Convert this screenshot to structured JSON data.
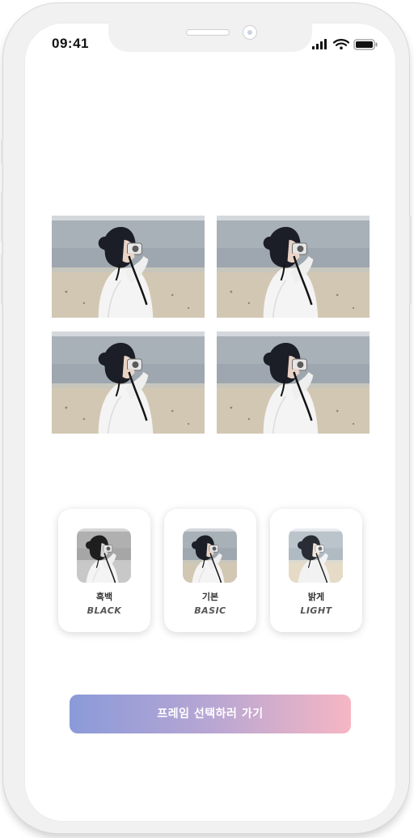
{
  "status_bar": {
    "time": "09:41",
    "icons": [
      "signal-icon",
      "wifi-icon",
      "battery-icon"
    ]
  },
  "preview": {
    "photos": [
      "beach-photo",
      "beach-photo",
      "beach-photo",
      "beach-photo"
    ]
  },
  "filters": [
    {
      "name": "흑백",
      "name_en": "BLACK",
      "style": "grayscale"
    },
    {
      "name": "기본",
      "name_en": "BASIC",
      "style": "normal"
    },
    {
      "name": "밝게",
      "name_en": "LIGHT",
      "style": "bright"
    }
  ],
  "cta": {
    "label": "프레임 선택하러 가기"
  },
  "colors": {
    "cta_gradient_start": "#8b9ad9",
    "cta_gradient_end": "#f6b6c3",
    "sky": "#c9cdd1",
    "sea": "#9aa3ab",
    "sand": "#cfc3ae"
  }
}
